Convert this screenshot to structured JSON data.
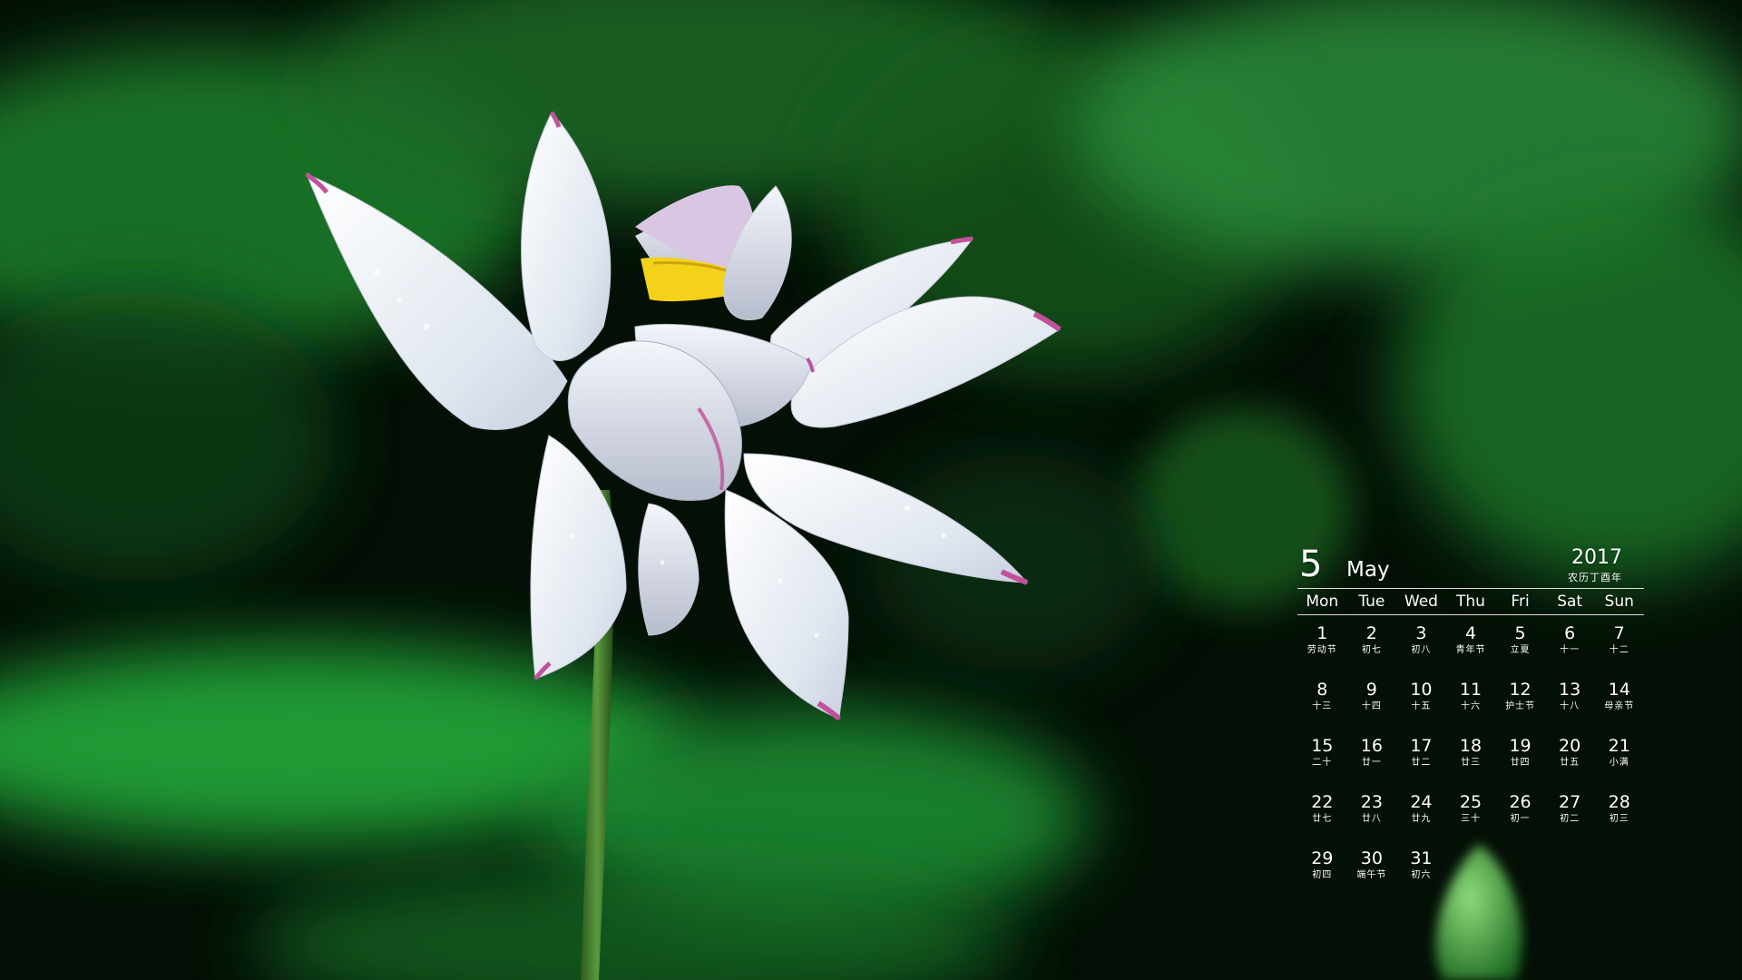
{
  "calendar": {
    "month_number": "5",
    "month_name": "May",
    "year": "2017",
    "lunar_year": "农历丁酉年",
    "weekdays": [
      "Mon",
      "Tue",
      "Wed",
      "Thu",
      "Fri",
      "Sat",
      "Sun"
    ],
    "days": [
      {
        "num": "1",
        "lunar": "劳动节"
      },
      {
        "num": "2",
        "lunar": "初七"
      },
      {
        "num": "3",
        "lunar": "初八"
      },
      {
        "num": "4",
        "lunar": "青年节"
      },
      {
        "num": "5",
        "lunar": "立夏"
      },
      {
        "num": "6",
        "lunar": "十一"
      },
      {
        "num": "7",
        "lunar": "十二"
      },
      {
        "num": "8",
        "lunar": "十三"
      },
      {
        "num": "9",
        "lunar": "十四"
      },
      {
        "num": "10",
        "lunar": "十五"
      },
      {
        "num": "11",
        "lunar": "十六"
      },
      {
        "num": "12",
        "lunar": "护士节"
      },
      {
        "num": "13",
        "lunar": "十八"
      },
      {
        "num": "14",
        "lunar": "母亲节"
      },
      {
        "num": "15",
        "lunar": "二十"
      },
      {
        "num": "16",
        "lunar": "廿一"
      },
      {
        "num": "17",
        "lunar": "廿二"
      },
      {
        "num": "18",
        "lunar": "廿三"
      },
      {
        "num": "19",
        "lunar": "廿四"
      },
      {
        "num": "20",
        "lunar": "廿五"
      },
      {
        "num": "21",
        "lunar": "小满"
      },
      {
        "num": "22",
        "lunar": "廿七"
      },
      {
        "num": "23",
        "lunar": "廿八"
      },
      {
        "num": "24",
        "lunar": "廿九"
      },
      {
        "num": "25",
        "lunar": "三十"
      },
      {
        "num": "26",
        "lunar": "初一"
      },
      {
        "num": "27",
        "lunar": "初二"
      },
      {
        "num": "28",
        "lunar": "初三"
      },
      {
        "num": "29",
        "lunar": "初四"
      },
      {
        "num": "30",
        "lunar": "端午节"
      },
      {
        "num": "31",
        "lunar": "初六"
      }
    ]
  },
  "colors": {
    "background_dark": "#041006",
    "leaf_green": "#1f8a2e",
    "petal_white": "#eef1f6",
    "petal_tip_pink": "#c2509a",
    "stamen_yellow": "#f4d21a",
    "stem_green": "#3f7a2c"
  }
}
